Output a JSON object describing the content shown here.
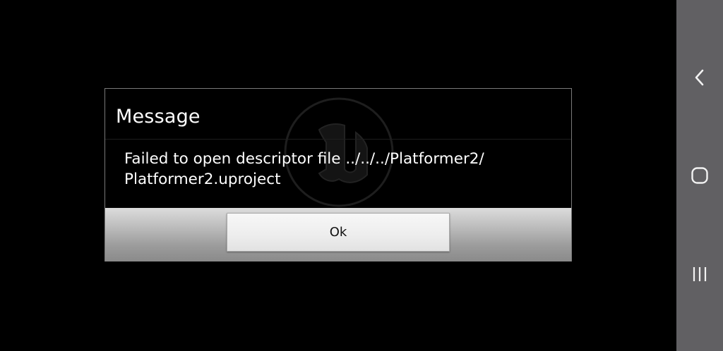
{
  "dialog": {
    "title": "Message",
    "message_line1": "Failed to open descriptor file ../../../Platformer2/",
    "message_line2": "Platformer2.uproject",
    "ok_label": "Ok"
  },
  "background": {
    "watermark_icon": "unreal-engine-logo-icon"
  },
  "navigation_bar": {
    "buttons": [
      "back-icon",
      "home-icon",
      "recents-icon"
    ]
  },
  "colors": {
    "screen_background": "#000000",
    "nav_bar": "#616063",
    "dialog_border": "#7a7a7a",
    "text": "#ffffff"
  }
}
